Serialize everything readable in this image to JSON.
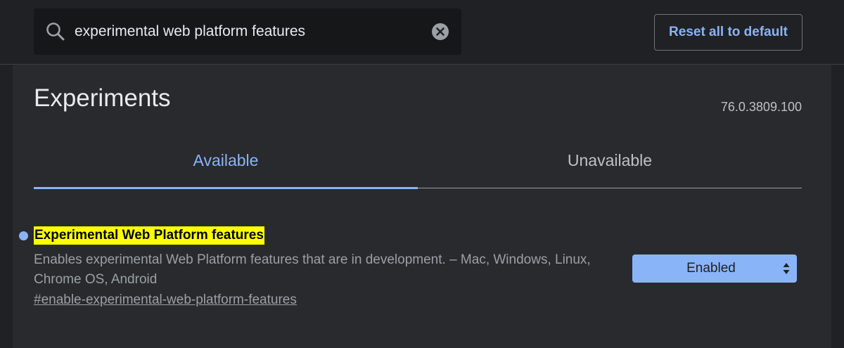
{
  "search": {
    "value": "experimental web platform features",
    "icon": "search-icon",
    "clear_icon": "clear-icon"
  },
  "header": {
    "reset_label": "Reset all to default"
  },
  "page": {
    "title": "Experiments",
    "version": "76.0.3809.100"
  },
  "tabs": [
    {
      "label": "Available",
      "active": true
    },
    {
      "label": "Unavailable",
      "active": false
    }
  ],
  "experiments": [
    {
      "name": "Experimental Web Platform features",
      "description": "Enables experimental Web Platform features that are in development. – Mac, Windows, Linux, Chrome OS, Android",
      "link": "#enable-experimental-web-platform-features",
      "state": "Enabled"
    }
  ],
  "colors": {
    "accent": "#8ab4f8",
    "highlight": "#ffff00",
    "background": "#202124",
    "panel": "#292a2d"
  }
}
